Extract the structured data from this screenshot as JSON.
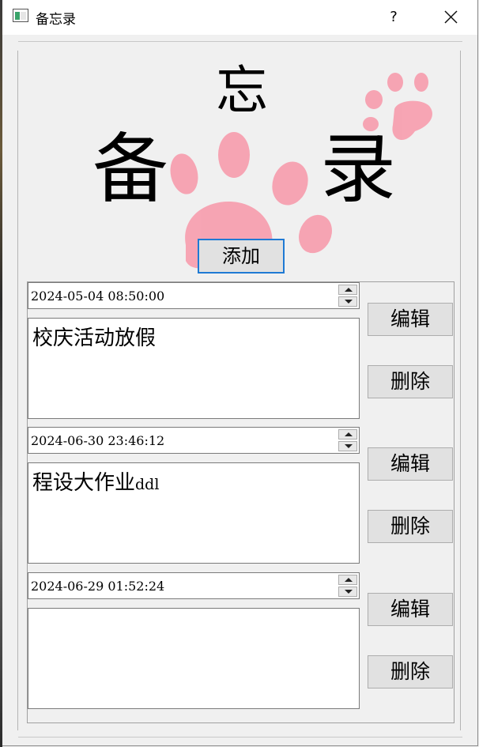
{
  "window": {
    "title": "备忘录",
    "help_label": "?",
    "close_label": ""
  },
  "header": {
    "char_top": "忘",
    "char_left": "备",
    "char_right": "录",
    "add_label": "添加"
  },
  "memos": [
    {
      "datetime": "2024-05-04 08:50:00",
      "text": "校庆活动放假",
      "text_suffix": "",
      "edit_label": "编辑",
      "delete_label": "删除"
    },
    {
      "datetime": "2024-06-30 23:46:12",
      "text": "程设大作业",
      "text_suffix": "ddl",
      "edit_label": "编辑",
      "delete_label": "删除"
    },
    {
      "datetime": "2024-06-29 01:52:24",
      "text": "",
      "text_suffix": "",
      "edit_label": "编辑",
      "delete_label": "删除"
    }
  ],
  "colors": {
    "paw": "#f7a0b0",
    "accent": "#1f7ad4"
  },
  "icons": {
    "close": "close-icon",
    "paw": "paw-print-icon",
    "app": "app-window-icon"
  }
}
